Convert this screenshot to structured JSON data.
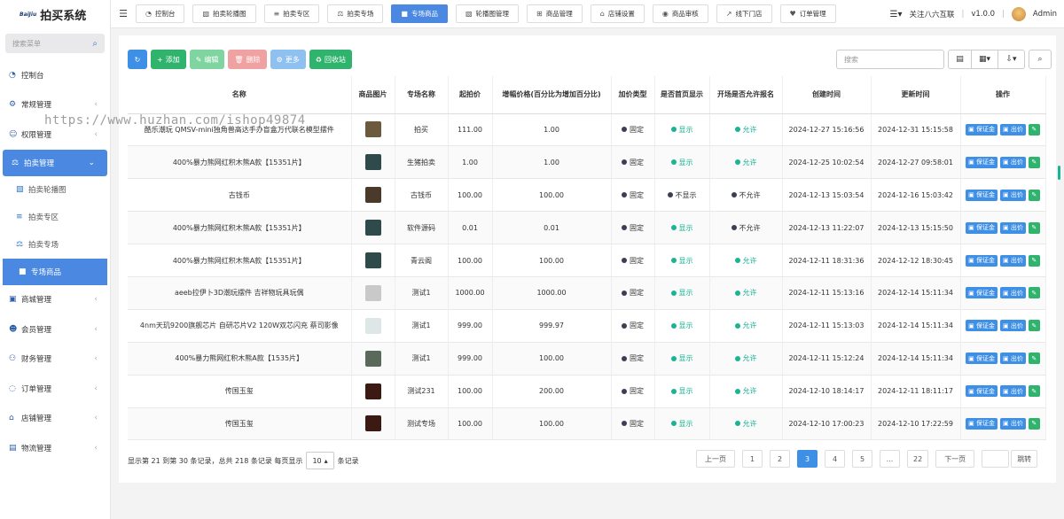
{
  "app": {
    "brand_small": "BaiJiu",
    "title": "拍买系统"
  },
  "sidebar": {
    "search_placeholder": "搜索菜单",
    "items": [
      {
        "label": "控制台",
        "icon": "dashboard-icon"
      },
      {
        "label": "常规管理",
        "icon": "gears-icon"
      },
      {
        "label": "权限管理",
        "icon": "users-icon"
      },
      {
        "label": "拍卖管理",
        "icon": "auction-icon"
      },
      {
        "label": "拍卖轮播图",
        "icon": "image-icon"
      },
      {
        "label": "拍卖专区",
        "icon": "list-icon"
      },
      {
        "label": "拍卖专场",
        "icon": "scale-icon"
      },
      {
        "label": "专场商品",
        "icon": "truck-icon"
      },
      {
        "label": "商城管理",
        "icon": "shop-icon"
      },
      {
        "label": "会员管理",
        "icon": "user-icon"
      },
      {
        "label": "财务管理",
        "icon": "finance-icon"
      },
      {
        "label": "订单管理",
        "icon": "order-icon"
      },
      {
        "label": "店铺管理",
        "icon": "store-icon"
      },
      {
        "label": "物流管理",
        "icon": "logistics-icon"
      }
    ]
  },
  "topnav": {
    "tabs": [
      {
        "label": "控制台",
        "icon": "dashboard-icon"
      },
      {
        "label": "拍卖轮播图",
        "icon": "image-icon"
      },
      {
        "label": "拍卖专区",
        "icon": "list-icon"
      },
      {
        "label": "拍卖专场",
        "icon": "scale-icon"
      },
      {
        "label": "专场商品",
        "icon": "truck-icon"
      },
      {
        "label": "轮播图管理",
        "icon": "image-icon"
      },
      {
        "label": "商品管理",
        "icon": "plus-square-icon"
      },
      {
        "label": "店铺设置",
        "icon": "store-icon"
      },
      {
        "label": "商品审核",
        "icon": "eye-icon"
      },
      {
        "label": "线下门店",
        "icon": "external-link-icon"
      },
      {
        "label": "订单管理",
        "icon": "heart-icon"
      }
    ],
    "follow": "关注八六互联",
    "version": "v1.0.0",
    "user": "Admin"
  },
  "toolbar": {
    "add": "添加",
    "edit": "编辑",
    "delete": "删除",
    "more": "更多",
    "recycle": "回收站",
    "search_placeholder": "搜索"
  },
  "table": {
    "headers": [
      "名称",
      "商品图片",
      "专场名称",
      "起拍价",
      "增幅价格(百分比为增加百分比)",
      "加价类型",
      "是否首页显示",
      "开场是否允许报名",
      "创建时间",
      "更新时间",
      "操作"
    ],
    "op_deposit": "保证金",
    "op_bid": "出价",
    "rows": [
      {
        "name": "酷乐潮玩 QMSV-mini独角兽高达手办盲盒万代联名模型摆件",
        "thumb": "#6b5a3e",
        "session": "拍买",
        "start": "111.00",
        "inc": "1.00",
        "type": "固定",
        "home": "显示",
        "allow": "允许",
        "created": "2024-12-27 15:16:56",
        "updated": "2024-12-31 15:15:58"
      },
      {
        "name": "400%暴力熊网红积木熊A款【15351片】",
        "thumb": "#2f4a4a",
        "session": "生猪拍卖",
        "start": "1.00",
        "inc": "1.00",
        "type": "固定",
        "home": "显示",
        "allow": "允许",
        "created": "2024-12-25 10:02:54",
        "updated": "2024-12-27 09:58:01"
      },
      {
        "name": "古钱币",
        "thumb": "#4a3a2a",
        "session": "古钱币",
        "start": "100.00",
        "inc": "100.00",
        "type": "固定",
        "home": "不显示",
        "allow": "不允许",
        "created": "2024-12-13 15:03:54",
        "updated": "2024-12-16 15:03:42"
      },
      {
        "name": "400%暴力熊网红积木熊A款【15351片】",
        "thumb": "#2f4a4a",
        "session": "软件源码",
        "start": "0.01",
        "inc": "0.01",
        "type": "固定",
        "home": "显示",
        "allow": "不允许",
        "created": "2024-12-13 11:22:07",
        "updated": "2024-12-13 15:15:50"
      },
      {
        "name": "400%暴力熊网红积木熊A款【15351片】",
        "thumb": "#2f4a4a",
        "session": "青云阁",
        "start": "100.00",
        "inc": "100.00",
        "type": "固定",
        "home": "显示",
        "allow": "允许",
        "created": "2024-12-11 18:31:36",
        "updated": "2024-12-12 18:30:45"
      },
      {
        "name": "aeeb拉伊卜3D潮玩摆件 吉祥物玩具玩偶",
        "thumb": "#c9c9c9",
        "session": "测试1",
        "start": "1000.00",
        "inc": "1000.00",
        "type": "固定",
        "home": "显示",
        "allow": "允许",
        "created": "2024-12-11 15:13:16",
        "updated": "2024-12-14 15:11:34"
      },
      {
        "name": "4nm天玑9200旗舰芯片 自研芯片V2 120W双芯闪充 蔡司影像",
        "thumb": "#dfe6e6",
        "session": "测试1",
        "start": "999.00",
        "inc": "999.97",
        "type": "固定",
        "home": "显示",
        "allow": "允许",
        "created": "2024-12-11 15:13:03",
        "updated": "2024-12-14 15:11:34"
      },
      {
        "name": "400%暴力熊网红积木熊A款【1535片】",
        "thumb": "#5a6a5a",
        "session": "测试1",
        "start": "999.00",
        "inc": "100.00",
        "type": "固定",
        "home": "显示",
        "allow": "允许",
        "created": "2024-12-11 15:12:24",
        "updated": "2024-12-14 15:11:34"
      },
      {
        "name": "传国玉玺",
        "thumb": "#3a1a12",
        "session": "测试231",
        "start": "100.00",
        "inc": "200.00",
        "type": "固定",
        "home": "显示",
        "allow": "允许",
        "created": "2024-12-10 18:14:17",
        "updated": "2024-12-11 18:11:17"
      },
      {
        "name": "传国玉玺",
        "thumb": "#3a1a12",
        "session": "测试专场",
        "start": "100.00",
        "inc": "100.00",
        "type": "固定",
        "home": "显示",
        "allow": "允许",
        "created": "2024-12-10 17:00:23",
        "updated": "2024-12-10 17:22:59"
      }
    ]
  },
  "footer": {
    "info": "显示第 21 到第 30 条记录，总共 218 条记录 每页显示",
    "page_size": "10",
    "suffix": "条记录",
    "prev": "上一页",
    "next": "下一页",
    "pages": [
      "1",
      "2",
      "3",
      "4",
      "5",
      "...",
      "22"
    ],
    "current": "3",
    "jump": "跳转"
  },
  "watermark": "https://www.huzhan.com/ishop49874",
  "colors": {
    "accent": "#4a88e2",
    "green": "#1ab394",
    "dark_dot": "#3b3f55"
  }
}
